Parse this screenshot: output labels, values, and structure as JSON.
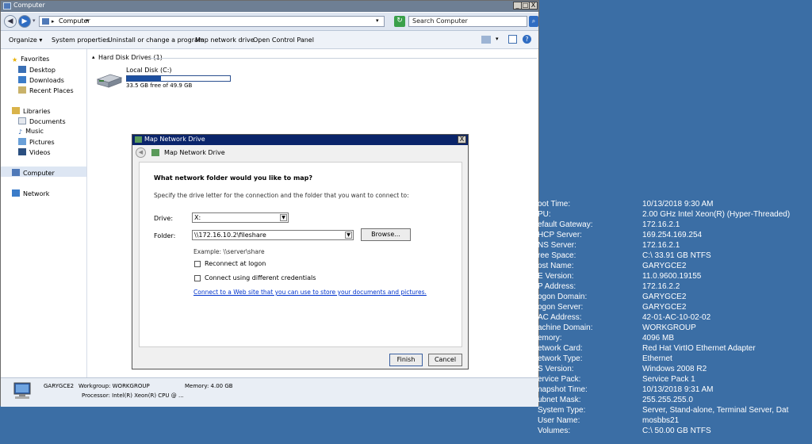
{
  "window": {
    "title": "Computer",
    "minimize": "_",
    "maximize": "□",
    "close": "X"
  },
  "address": {
    "path": "Computer",
    "search_placeholder": "Search Computer"
  },
  "toolbar": {
    "organize": "Organize",
    "system_properties": "System properties",
    "uninstall": "Uninstall or change a program",
    "map_drive": "Map network drive",
    "control_panel": "Open Control Panel"
  },
  "nav": {
    "favorites": "Favorites",
    "desktop": "Desktop",
    "downloads": "Downloads",
    "recent": "Recent Places",
    "libraries": "Libraries",
    "documents": "Documents",
    "music": "Music",
    "pictures": "Pictures",
    "videos": "Videos",
    "computer": "Computer",
    "network": "Network"
  },
  "content": {
    "group_header": "Hard Disk Drives (1)",
    "drive_name": "Local Disk (C:)",
    "drive_free": "33.5 GB free of 49.9 GB",
    "drive_used_fraction": 0.33
  },
  "details": {
    "computer_name": "GARYGCE2",
    "workgroup": "Workgroup: WORKGROUP",
    "memory": "Memory: 4.00 GB",
    "processor": "Processor: Intel(R) Xeon(R) CPU @ ..."
  },
  "dialog": {
    "title": "Map Network Drive",
    "heading": "Map Network Drive",
    "question": "What network folder would you like to map?",
    "instruction": "Specify the drive letter for the connection and the folder that you want to connect to:",
    "drive_label": "Drive:",
    "drive_value": "X:",
    "folder_label": "Folder:",
    "folder_value": "\\\\172.16.10.2\\fileshare",
    "browse": "Browse...",
    "example": "Example: \\\\server\\share",
    "reconnect": "Reconnect at logon",
    "diff_credentials": "Connect using different credentials",
    "web_link": "Connect to a Web site that you can use to store your documents and pictures.",
    "finish": "Finish",
    "cancel": "Cancel",
    "close": "X"
  },
  "sysinfo": [
    {
      "label": "oot Time:",
      "value": "10/13/2018 9:30 AM"
    },
    {
      "label": "PU:",
      "value": "2.00 GHz Intel Xeon(R) (Hyper-Threaded)"
    },
    {
      "label": "efault Gateway:",
      "value": "172.16.2.1"
    },
    {
      "label": "HCP Server:",
      "value": "169.254.169.254"
    },
    {
      "label": "NS Server:",
      "value": "172.16.2.1"
    },
    {
      "label": "ree Space:",
      "value": "C:\\ 33.91 GB NTFS"
    },
    {
      "label": "ost Name:",
      "value": "GARYGCE2"
    },
    {
      "label": "E Version:",
      "value": "11.0.9600.19155"
    },
    {
      "label": "P Address:",
      "value": "172.16.2.2"
    },
    {
      "label": "ogon Domain:",
      "value": "GARYGCE2"
    },
    {
      "label": "ogon Server:",
      "value": "GARYGCE2"
    },
    {
      "label": "AC Address:",
      "value": "42-01-AC-10-02-02"
    },
    {
      "label": "achine Domain:",
      "value": "WORKGROUP"
    },
    {
      "label": "emory:",
      "value": "4096 MB"
    },
    {
      "label": "etwork Card:",
      "value": "Red Hat VirtIO Ethernet Adapter"
    },
    {
      "label": "etwork Type:",
      "value": "Ethernet"
    },
    {
      "label": "S Version:",
      "value": "Windows 2008 R2"
    },
    {
      "label": "ervice Pack:",
      "value": "Service Pack 1"
    },
    {
      "label": "napshot Time:",
      "value": "10/13/2018 9:31 AM"
    },
    {
      "label": "ubnet Mask:",
      "value": "255.255.255.0"
    },
    {
      "label": "System Type:",
      "value": "Server, Stand-alone, Terminal Server, Dat"
    },
    {
      "label": "User Name:",
      "value": "mosbbs21"
    },
    {
      "label": "Volumes:",
      "value": "C:\\ 50.00 GB NTFS"
    }
  ],
  "colors": {
    "desktop": "#3b6ea5",
    "dialog_title": "#0a246a",
    "link": "#0033cc",
    "drive_bar": "#1c4fa0"
  }
}
